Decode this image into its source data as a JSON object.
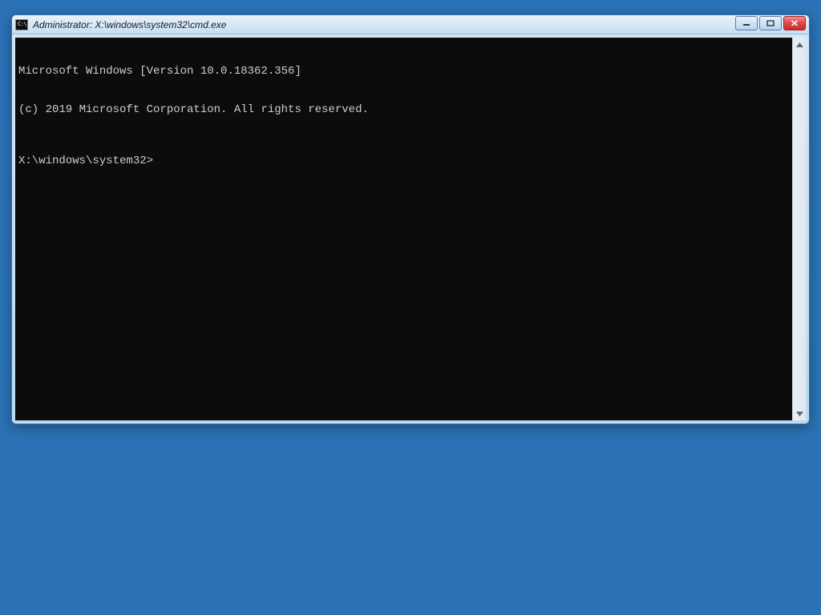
{
  "window": {
    "title": "Administrator: X:\\windows\\system32\\cmd.exe",
    "icon_label": "C:\\"
  },
  "console": {
    "version_line": "Microsoft Windows [Version 10.0.18362.356]",
    "copyright_line": "(c) 2019 Microsoft Corporation. All rights reserved.",
    "prompt": "X:\\windows\\system32>",
    "input": ""
  }
}
